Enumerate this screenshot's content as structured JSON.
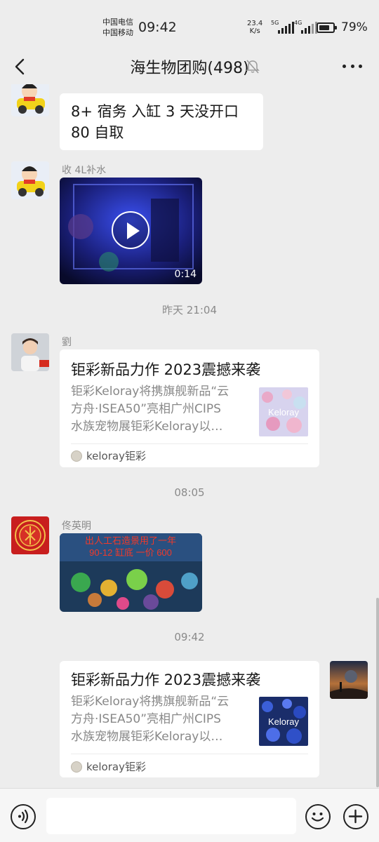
{
  "status_bar": {
    "carrier_1": "中国电信",
    "carrier_2": "中国移动",
    "time": "09:42",
    "net_speed_value": "23.4",
    "net_speed_unit": "K/s",
    "signal_1_label": "5G",
    "signal_2_label": "4G",
    "battery_percent": "79%",
    "battery_level": 0.79
  },
  "header": {
    "title": "海生物团购(498)",
    "muted": true,
    "back_icon": "chevron-left-icon",
    "mute_icon": "bell-off-icon",
    "more_icon": "more-horizontal-icon"
  },
  "messages": [
    {
      "type": "text",
      "text_line_1": "8+ 宿务  入缸 3 天没开口",
      "text_line_2": "80 自取"
    },
    {
      "type": "video",
      "sender": "收 4L补水",
      "duration": "0:14"
    },
    {
      "type": "time",
      "text": "昨天 21:04"
    },
    {
      "type": "link",
      "sender": "劉",
      "title": "钜彩新品力作 2023震撼来袭",
      "desc_line_1": "钜彩Keloray将携旗舰新品“云",
      "desc_line_2": "方舟·ISEA50”亮相广州CIPS",
      "desc_line_3": "水族宠物展钜彩Keloray以…",
      "source": "keloray钜彩",
      "thumb_text": "Keloray"
    },
    {
      "type": "time",
      "text": "08:05"
    },
    {
      "type": "image",
      "sender": "佟英明",
      "image_caption_1": "出人工石造景用了一年",
      "image_caption_2": "90-12 缸底 一价 600"
    },
    {
      "type": "time",
      "text": "09:42"
    },
    {
      "type": "link",
      "self": true,
      "title": "钜彩新品力作 2023震撼来袭",
      "desc_line_1": "钜彩Keloray将携旗舰新品“云",
      "desc_line_2": "方舟·ISEA50”亮相广州CIPS",
      "desc_line_3": "水族宠物展钜彩Keloray以…",
      "source": "keloray钜彩",
      "thumb_text": "Keloray"
    }
  ],
  "input_bar": {
    "voice_icon": "voice-icon",
    "emoji_icon": "emoji-icon",
    "add_icon": "plus-circle-icon"
  },
  "colors": {
    "background": "#ededed",
    "bubble": "#ffffff",
    "time_label": "#8a8a8a"
  }
}
